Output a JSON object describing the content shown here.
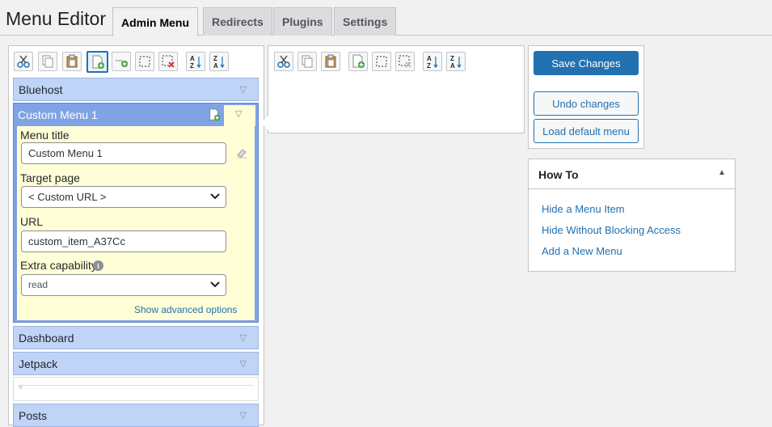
{
  "page": {
    "title": "Menu Editor"
  },
  "tabs": [
    {
      "label": "Admin Menu",
      "active": true
    },
    {
      "label": "Redirects"
    },
    {
      "label": "Plugins"
    },
    {
      "label": "Settings"
    }
  ],
  "toolbar_icons": [
    "cut-icon",
    "copy-icon",
    "paste-icon",
    "new-menu-icon",
    "new-separator-icon",
    "hide-icon",
    "delete-icon",
    "sort-ascending-icon",
    "sort-descending-icon"
  ],
  "menu_items": {
    "bluehost": "Bluehost",
    "dashboard": "Dashboard",
    "jetpack": "Jetpack",
    "posts": "Posts"
  },
  "custom_menu": {
    "header": "Custom Menu 1",
    "title_label": "Menu title",
    "title_value": "Custom Menu 1",
    "target_label": "Target page",
    "target_value": "< Custom URL >",
    "url_label": "URL",
    "url_value": "custom_item_A37Cc",
    "capability_label": "Extra capability",
    "capability_value": "read",
    "advanced_link": "Show advanced options"
  },
  "actions": {
    "save": "Save Changes",
    "undo": "Undo changes",
    "load_default": "Load default menu"
  },
  "howto": {
    "title": "How To",
    "links": [
      "Hide a Menu Item",
      "Hide Without Blocking Access",
      "Add a New Menu"
    ]
  },
  "colors": {
    "menu_item_bg": "#bfd4f7",
    "selected_menu_bg": "#7fa3e5",
    "editor_bg": "#fffed6",
    "primary": "#2271b1"
  }
}
